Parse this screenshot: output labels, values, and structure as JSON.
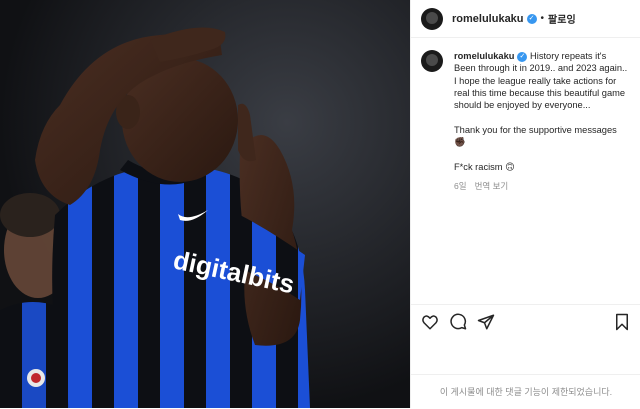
{
  "post": {
    "username": "romelulukaku",
    "separator": "•",
    "follow_label": "팔로잉",
    "caption": "History repeats it's Been through it in 2019.. and 2023 again..\nI hope the league really take actions for real this time because this beautiful game should be enjoyed by everyone...\n\nThank you for the supportive messages ✊🏿\n\nF*ck racism 🙃",
    "time_ago": "6일",
    "translate_label": "번역 보기",
    "comments_disabled": "이 게시물에 대한 댓글 기능이 제한되었습니다."
  },
  "photo": {
    "jersey_sponsor": "digitalbits"
  },
  "icons": [
    "verified-badge-icon",
    "heart-icon",
    "comment-icon",
    "share-icon",
    "bookmark-icon"
  ],
  "colors": {
    "verified": "#3797f0",
    "jersey_blue": "#1b4fd6",
    "jersey_black": "#0d0f14"
  }
}
